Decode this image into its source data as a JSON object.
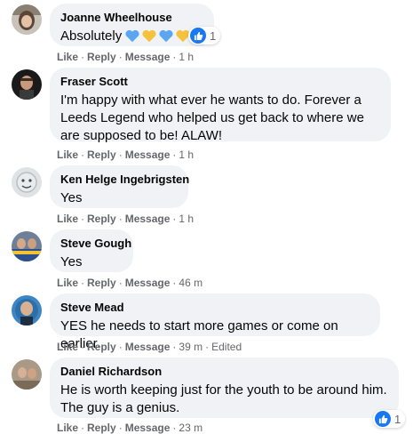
{
  "comments": [
    {
      "name": "Joanne Wheelhouse",
      "text": "Absolutely",
      "emoji": [
        "blue-heart",
        "yellow-heart",
        "blue-heart",
        "yellow-heart"
      ],
      "reaction_count": "1",
      "actions": {
        "like": "Like",
        "reply": "Reply",
        "message": "Message",
        "time": "1 h"
      }
    },
    {
      "name": "Fraser Scott",
      "text": "I'm happy with what ever he wants to do. Forever a Leeds Legend who helped us get back to where we are supposed to be! ALAW!",
      "actions": {
        "like": "Like",
        "reply": "Reply",
        "message": "Message",
        "time": "1 h"
      }
    },
    {
      "name": "Ken Helge Ingebrigsten",
      "text": "Yes",
      "actions": {
        "like": "Like",
        "reply": "Reply",
        "message": "Message",
        "time": "1 h"
      }
    },
    {
      "name": "Steve Gough",
      "text": "Yes",
      "actions": {
        "like": "Like",
        "reply": "Reply",
        "message": "Message",
        "time": "46 m"
      }
    },
    {
      "name": "Steve Mead",
      "text": "YES he needs to start more games or come on earlier.",
      "actions": {
        "like": "Like",
        "reply": "Reply",
        "message": "Message",
        "time": "39 m",
        "edited": "Edited"
      }
    },
    {
      "name": "Daniel Richardson",
      "text": "He is worth keeping just for the youth to be around him. The guy is a genius.",
      "reaction_count": "1",
      "actions": {
        "like": "Like",
        "reply": "Reply",
        "message": "Message",
        "time": "23 m"
      }
    }
  ],
  "colors": {
    "bubble": "#f0f2f5",
    "text": "#050505",
    "meta": "#65676b",
    "like_blue": "#1877f2",
    "blue_heart": "#5aa6f0",
    "yellow_heart": "#f5c33b"
  },
  "icons": {
    "like": "like-thumb-icon",
    "blue_heart": "blue-heart-icon",
    "yellow_heart": "yellow-heart-icon"
  }
}
